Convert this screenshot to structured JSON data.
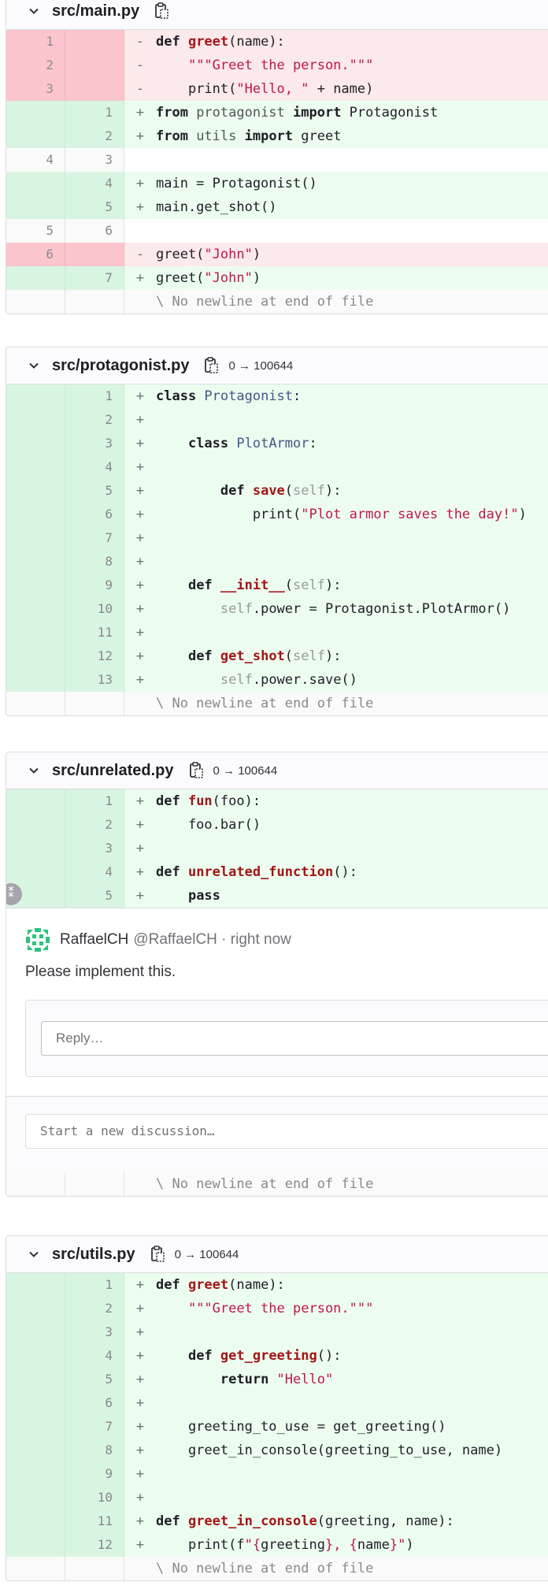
{
  "files": [
    {
      "name": "src/main.py",
      "mode": "",
      "lines": [
        {
          "type": "del",
          "old": "1",
          "new": "",
          "mark": "-",
          "segs": [
            [
              "kw",
              "def "
            ],
            [
              "fn",
              "greet"
            ],
            [
              "",
              "(name):"
            ]
          ]
        },
        {
          "type": "del",
          "old": "2",
          "new": "",
          "mark": "-",
          "segs": [
            [
              "",
              "    "
            ],
            [
              "str",
              "\"\"\"Greet the person.\"\"\""
            ]
          ]
        },
        {
          "type": "del",
          "old": "3",
          "new": "",
          "mark": "-",
          "segs": [
            [
              "",
              "    print("
            ],
            [
              "str",
              "\"Hello, \""
            ],
            [
              "",
              " + name)"
            ]
          ]
        },
        {
          "type": "add",
          "old": "",
          "new": "1",
          "mark": "+",
          "segs": [
            [
              "kw",
              "from"
            ],
            [
              "name",
              " protagonist "
            ],
            [
              "kw",
              "import"
            ],
            [
              "",
              " Protagonist"
            ]
          ]
        },
        {
          "type": "add",
          "old": "",
          "new": "2",
          "mark": "+",
          "segs": [
            [
              "kw",
              "from"
            ],
            [
              "name",
              " utils "
            ],
            [
              "kw",
              "import"
            ],
            [
              "",
              " greet"
            ]
          ]
        },
        {
          "type": "ctx",
          "old": "4",
          "new": "3",
          "mark": "",
          "segs": [
            [
              "",
              ""
            ]
          ]
        },
        {
          "type": "add",
          "old": "",
          "new": "4",
          "mark": "+",
          "segs": [
            [
              "",
              "main = Protagonist()"
            ]
          ]
        },
        {
          "type": "add",
          "old": "",
          "new": "5",
          "mark": "+",
          "segs": [
            [
              "",
              "main.get_shot()"
            ]
          ]
        },
        {
          "type": "ctx",
          "old": "5",
          "new": "6",
          "mark": "",
          "segs": [
            [
              "",
              ""
            ]
          ]
        },
        {
          "type": "del",
          "old": "6",
          "new": "",
          "mark": "-",
          "segs": [
            [
              "",
              "greet("
            ],
            [
              "str",
              "\"John\""
            ],
            [
              "",
              ")"
            ]
          ]
        },
        {
          "type": "add",
          "old": "",
          "new": "7",
          "mark": "+",
          "segs": [
            [
              "",
              "greet("
            ],
            [
              "str",
              "\"John\""
            ],
            [
              "",
              ")"
            ]
          ]
        },
        {
          "type": "nonl",
          "old": "",
          "new": "",
          "mark": "",
          "segs": [
            [
              "",
              "\\ No newline at end of file"
            ]
          ]
        }
      ]
    },
    {
      "name": "src/protagonist.py",
      "mode": "0 → 100644",
      "lines": [
        {
          "type": "add",
          "old": "",
          "new": "1",
          "mark": "+",
          "segs": [
            [
              "kw",
              "class "
            ],
            [
              "cls",
              "Protagonist"
            ],
            [
              "",
              ":"
            ]
          ]
        },
        {
          "type": "add",
          "old": "",
          "new": "2",
          "mark": "+",
          "segs": [
            [
              "",
              ""
            ]
          ]
        },
        {
          "type": "add",
          "old": "",
          "new": "3",
          "mark": "+",
          "segs": [
            [
              "",
              "    "
            ],
            [
              "kw",
              "class "
            ],
            [
              "cls",
              "PlotArmor"
            ],
            [
              "",
              ":"
            ]
          ]
        },
        {
          "type": "add",
          "old": "",
          "new": "4",
          "mark": "+",
          "segs": [
            [
              "",
              ""
            ]
          ]
        },
        {
          "type": "add",
          "old": "",
          "new": "5",
          "mark": "+",
          "segs": [
            [
              "",
              "        "
            ],
            [
              "kw",
              "def "
            ],
            [
              "fn",
              "save"
            ],
            [
              "",
              "("
            ],
            [
              "self",
              "self"
            ],
            [
              "",
              "):"
            ]
          ]
        },
        {
          "type": "add",
          "old": "",
          "new": "6",
          "mark": "+",
          "segs": [
            [
              "",
              "            print("
            ],
            [
              "str",
              "\"Plot armor saves the day!\""
            ],
            [
              "",
              ")"
            ]
          ]
        },
        {
          "type": "add",
          "old": "",
          "new": "7",
          "mark": "+",
          "segs": [
            [
              "",
              ""
            ]
          ]
        },
        {
          "type": "add",
          "old": "",
          "new": "8",
          "mark": "+",
          "segs": [
            [
              "",
              ""
            ]
          ]
        },
        {
          "type": "add",
          "old": "",
          "new": "9",
          "mark": "+",
          "segs": [
            [
              "",
              "    "
            ],
            [
              "kw",
              "def "
            ],
            [
              "fn",
              "__init__"
            ],
            [
              "",
              "("
            ],
            [
              "self",
              "self"
            ],
            [
              "",
              "):"
            ]
          ]
        },
        {
          "type": "add",
          "old": "",
          "new": "10",
          "mark": "+",
          "segs": [
            [
              "",
              "        "
            ],
            [
              "self",
              "self"
            ],
            [
              "",
              ".power = Protagonist.PlotArmor()"
            ]
          ]
        },
        {
          "type": "add",
          "old": "",
          "new": "11",
          "mark": "+",
          "segs": [
            [
              "",
              ""
            ]
          ]
        },
        {
          "type": "add",
          "old": "",
          "new": "12",
          "mark": "+",
          "segs": [
            [
              "",
              "    "
            ],
            [
              "kw",
              "def "
            ],
            [
              "fn",
              "get_shot"
            ],
            [
              "",
              "("
            ],
            [
              "self",
              "self"
            ],
            [
              "",
              "):"
            ]
          ]
        },
        {
          "type": "add",
          "old": "",
          "new": "13",
          "mark": "+",
          "segs": [
            [
              "",
              "        "
            ],
            [
              "self",
              "self"
            ],
            [
              "",
              ".power.save()"
            ]
          ]
        },
        {
          "type": "nonl",
          "old": "",
          "new": "",
          "mark": "",
          "segs": [
            [
              "",
              "\\ No newline at end of file"
            ]
          ]
        }
      ]
    },
    {
      "name": "src/unrelated.py",
      "mode": "0 → 100644",
      "lines": [
        {
          "type": "add",
          "old": "",
          "new": "1",
          "mark": "+",
          "segs": [
            [
              "kw",
              "def "
            ],
            [
              "fn",
              "fun"
            ],
            [
              "",
              "(foo):"
            ]
          ]
        },
        {
          "type": "add",
          "old": "",
          "new": "2",
          "mark": "+",
          "segs": [
            [
              "",
              "    foo.bar()"
            ]
          ]
        },
        {
          "type": "add",
          "old": "",
          "new": "3",
          "mark": "+",
          "segs": [
            [
              "",
              ""
            ]
          ]
        },
        {
          "type": "add",
          "old": "",
          "new": "4",
          "mark": "+",
          "segs": [
            [
              "kw",
              "def "
            ],
            [
              "fn",
              "unrelated_function"
            ],
            [
              "",
              "():"
            ]
          ]
        },
        {
          "type": "add",
          "old": "",
          "new": "5",
          "mark": "+",
          "segs": [
            [
              "",
              "    "
            ],
            [
              "kw",
              "pass"
            ]
          ]
        }
      ],
      "discussion": {
        "author": "RaffaelCH",
        "meta": "@RaffaelCH · right now",
        "body": "Please implement this.",
        "reply_placeholder": "Reply…",
        "new_discussion_placeholder": "Start a new discussion…"
      },
      "trailing": [
        {
          "type": "nonl",
          "old": "",
          "new": "",
          "mark": "",
          "segs": [
            [
              "",
              "\\ No newline at end of file"
            ]
          ]
        }
      ]
    },
    {
      "name": "src/utils.py",
      "mode": "0 → 100644",
      "lines": [
        {
          "type": "add",
          "old": "",
          "new": "1",
          "mark": "+",
          "segs": [
            [
              "kw",
              "def "
            ],
            [
              "fn",
              "greet"
            ],
            [
              "",
              "(name):"
            ]
          ]
        },
        {
          "type": "add",
          "old": "",
          "new": "2",
          "mark": "+",
          "segs": [
            [
              "",
              "    "
            ],
            [
              "str",
              "\"\"\"Greet the person.\"\"\""
            ]
          ]
        },
        {
          "type": "add",
          "old": "",
          "new": "3",
          "mark": "+",
          "segs": [
            [
              "",
              ""
            ]
          ]
        },
        {
          "type": "add",
          "old": "",
          "new": "4",
          "mark": "+",
          "segs": [
            [
              "",
              "    "
            ],
            [
              "kw",
              "def "
            ],
            [
              "fn",
              "get_greeting"
            ],
            [
              "",
              "():"
            ]
          ]
        },
        {
          "type": "add",
          "old": "",
          "new": "5",
          "mark": "+",
          "segs": [
            [
              "",
              "        "
            ],
            [
              "kw",
              "return "
            ],
            [
              "str",
              "\"Hello\""
            ]
          ]
        },
        {
          "type": "add",
          "old": "",
          "new": "6",
          "mark": "+",
          "segs": [
            [
              "",
              ""
            ]
          ]
        },
        {
          "type": "add",
          "old": "",
          "new": "7",
          "mark": "+",
          "segs": [
            [
              "",
              "    greeting_to_use = get_greeting()"
            ]
          ]
        },
        {
          "type": "add",
          "old": "",
          "new": "8",
          "mark": "+",
          "segs": [
            [
              "",
              "    greet_in_console(greeting_to_use, name)"
            ]
          ]
        },
        {
          "type": "add",
          "old": "",
          "new": "9",
          "mark": "+",
          "segs": [
            [
              "",
              ""
            ]
          ]
        },
        {
          "type": "add",
          "old": "",
          "new": "10",
          "mark": "+",
          "segs": [
            [
              "",
              ""
            ]
          ]
        },
        {
          "type": "add",
          "old": "",
          "new": "11",
          "mark": "+",
          "segs": [
            [
              "kw",
              "def "
            ],
            [
              "fn",
              "greet_in_console"
            ],
            [
              "",
              "(greeting, name):"
            ]
          ]
        },
        {
          "type": "add",
          "old": "",
          "new": "12",
          "mark": "+",
          "segs": [
            [
              "",
              "    print(f"
            ],
            [
              "str",
              "\"{"
            ],
            [
              "",
              "greeting"
            ],
            [
              "str",
              "}, {"
            ],
            [
              "",
              "name"
            ],
            [
              "str",
              "}\""
            ],
            [
              "",
              ")"
            ]
          ]
        },
        {
          "type": "nonl",
          "old": "",
          "new": "",
          "mark": "",
          "segs": [
            [
              "",
              "\\ No newline at end of file"
            ]
          ]
        }
      ]
    }
  ],
  "colors": {
    "addition": "#ecfdf0",
    "deletion": "#fbe9eb",
    "header": "#fbfafd"
  }
}
